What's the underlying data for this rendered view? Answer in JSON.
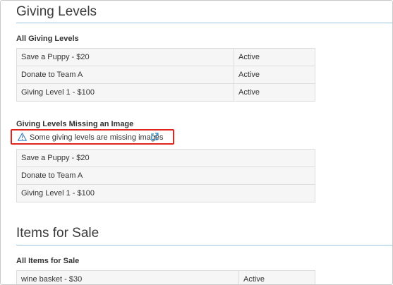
{
  "giving_levels": {
    "title": "Giving Levels",
    "all_subtitle": "All Giving Levels",
    "rows": [
      {
        "name": "Save a Puppy - $20",
        "status": "Active"
      },
      {
        "name": "Donate to Team A",
        "status": "Active"
      },
      {
        "name": "Giving Level 1 - $100",
        "status": "Active"
      }
    ],
    "missing_subtitle": "Giving Levels Missing an Image",
    "warning": {
      "text": "Some giving levels are missing images",
      "icon": "warning-triangle-icon",
      "link_icon": "external-link-icon",
      "highlight_color": "#e0261c"
    },
    "missing_rows": [
      {
        "name": "Save a Puppy - $20"
      },
      {
        "name": "Donate to Team A"
      },
      {
        "name": "Giving Level 1 - $100"
      }
    ]
  },
  "items_for_sale": {
    "title": "Items for Sale",
    "all_subtitle": "All Items for Sale",
    "rows": [
      {
        "name": "wine basket - $30",
        "status": "Active"
      }
    ]
  },
  "colors": {
    "rule": "#9cc6df",
    "link_icon": "#2f86c1",
    "table_bg": "#f6f6f6"
  }
}
